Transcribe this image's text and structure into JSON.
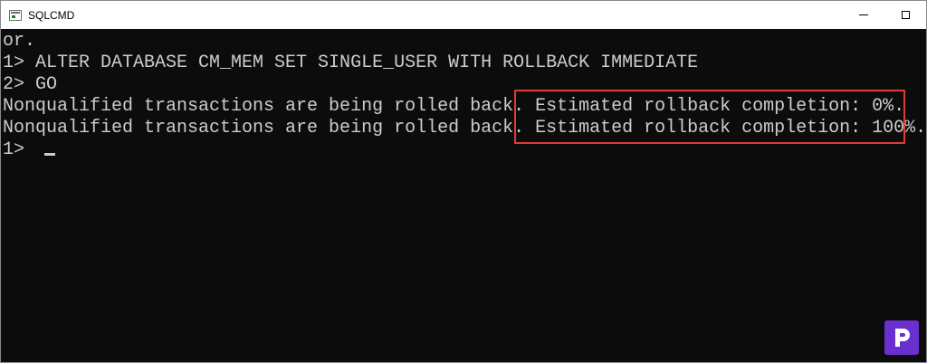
{
  "window": {
    "title": "SQLCMD"
  },
  "terminal": {
    "lines": [
      "or.",
      "1> ALTER DATABASE CM_MEM SET SINGLE_USER WITH ROLLBACK IMMEDIATE",
      "2> GO",
      "Nonqualified transactions are being rolled back. Estimated rollback completion: 0%.",
      "Nonqualified transactions are being rolled back. Estimated rollback completion: 100%.",
      "1> "
    ]
  },
  "colors": {
    "terminal_bg": "#0c0c0c",
    "terminal_text": "#cccccc",
    "highlight": "#e23b3b",
    "logo": "#6a2fcf"
  },
  "icons": {
    "app": "console-app-icon",
    "minimize": "minimize-icon",
    "maximize": "maximize-icon",
    "logo": "prajwal-logo-icon"
  }
}
